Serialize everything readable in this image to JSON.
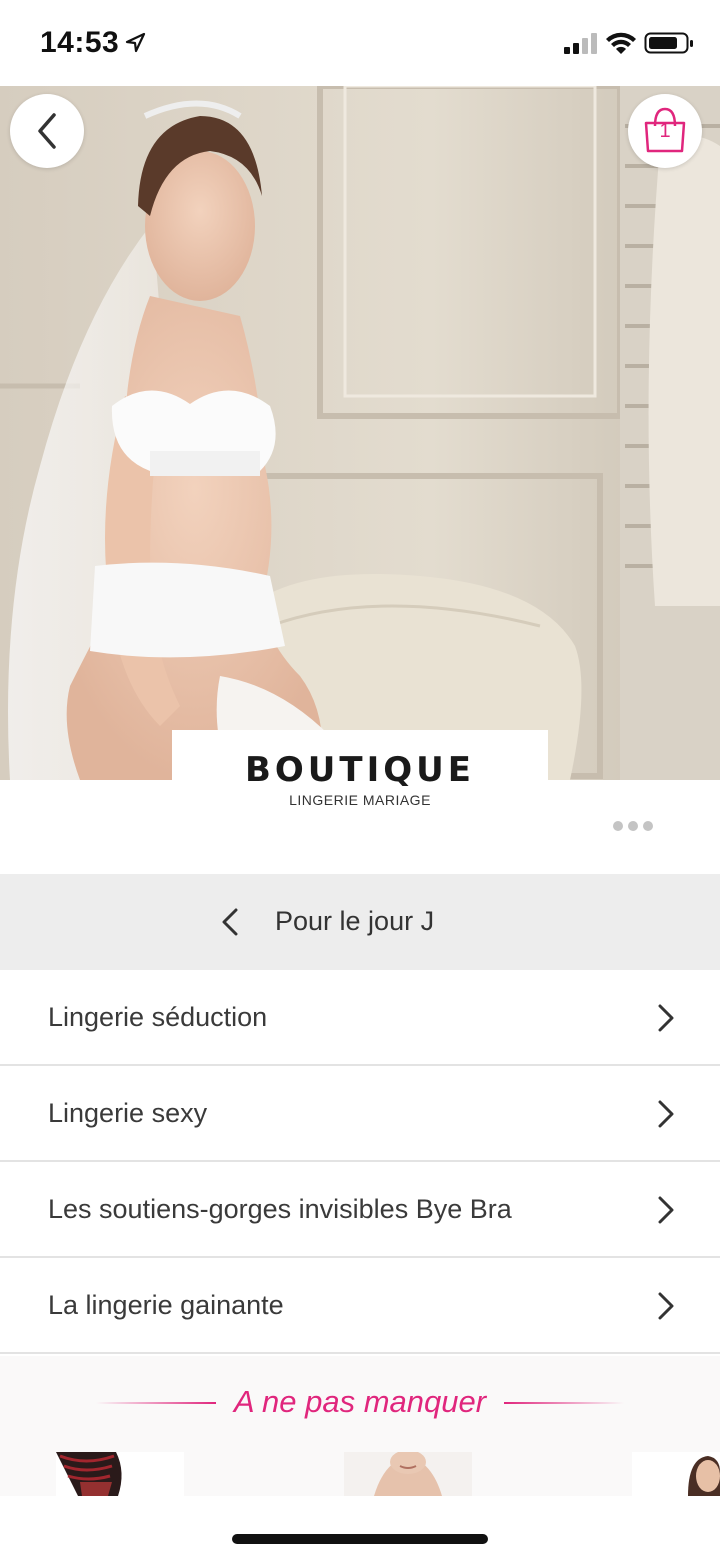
{
  "status_bar": {
    "time": "14:53",
    "icons": [
      "location-arrow-icon",
      "cellular-signal-icon",
      "wifi-icon",
      "battery-icon"
    ]
  },
  "hero": {
    "image": "bride-in-white-lingerie-photo",
    "back_icon": "chevron-left-icon",
    "cart_icon": "shopping-bag-icon",
    "cart_count": "1"
  },
  "brand": {
    "title": "BOUTIQUE",
    "subtitle": "LINGERIE MARIAGE",
    "more_icon": "ellipsis-icon"
  },
  "category": {
    "title": "Pour le jour J",
    "back_icon": "chevron-left-icon"
  },
  "menu": {
    "items": [
      {
        "label": "Lingerie séduction"
      },
      {
        "label": "Lingerie sexy"
      },
      {
        "label": "Les soutiens-gorges invisibles Bye Bra"
      },
      {
        "label": "La lingerie gainante"
      }
    ]
  },
  "promo": {
    "title": "A ne pas manquer",
    "thumbnails": [
      "lace-stockings-thumbnail",
      "model-portrait-thumbnail",
      "model-portrait-thumbnail"
    ]
  },
  "colors": {
    "accent": "#e0267d",
    "header_bg": "#ededed",
    "text": "#333333"
  }
}
